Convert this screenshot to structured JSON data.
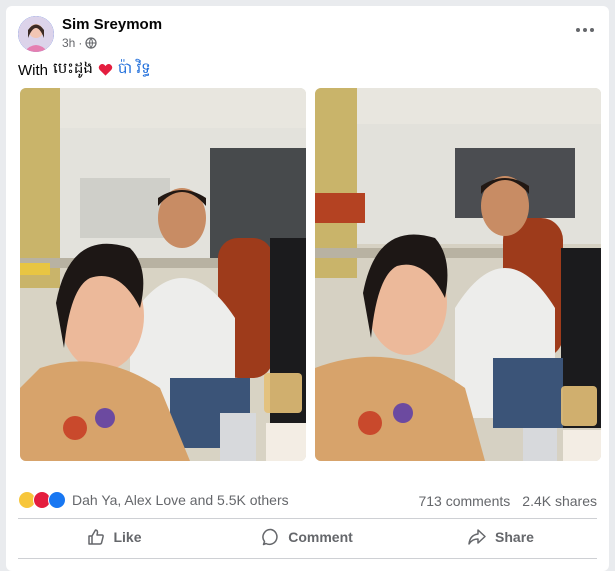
{
  "post": {
    "author": "Sim Sreymom",
    "time": "3h",
    "text_prefix": "With",
    "text_khmer": "បេះដូង",
    "tag": "ប៉ា វិទ្ធ"
  },
  "engagement": {
    "reactions_text": "Dah Ya, Alex Love and 5.5K others",
    "comments": "713 comments",
    "shares": "2.4K shares"
  },
  "actions": {
    "like": "Like",
    "comment": "Comment",
    "share": "Share"
  },
  "colors": {
    "link": "#216fdb",
    "heart": "#e41e3f",
    "like_blue": "#1877f2"
  }
}
